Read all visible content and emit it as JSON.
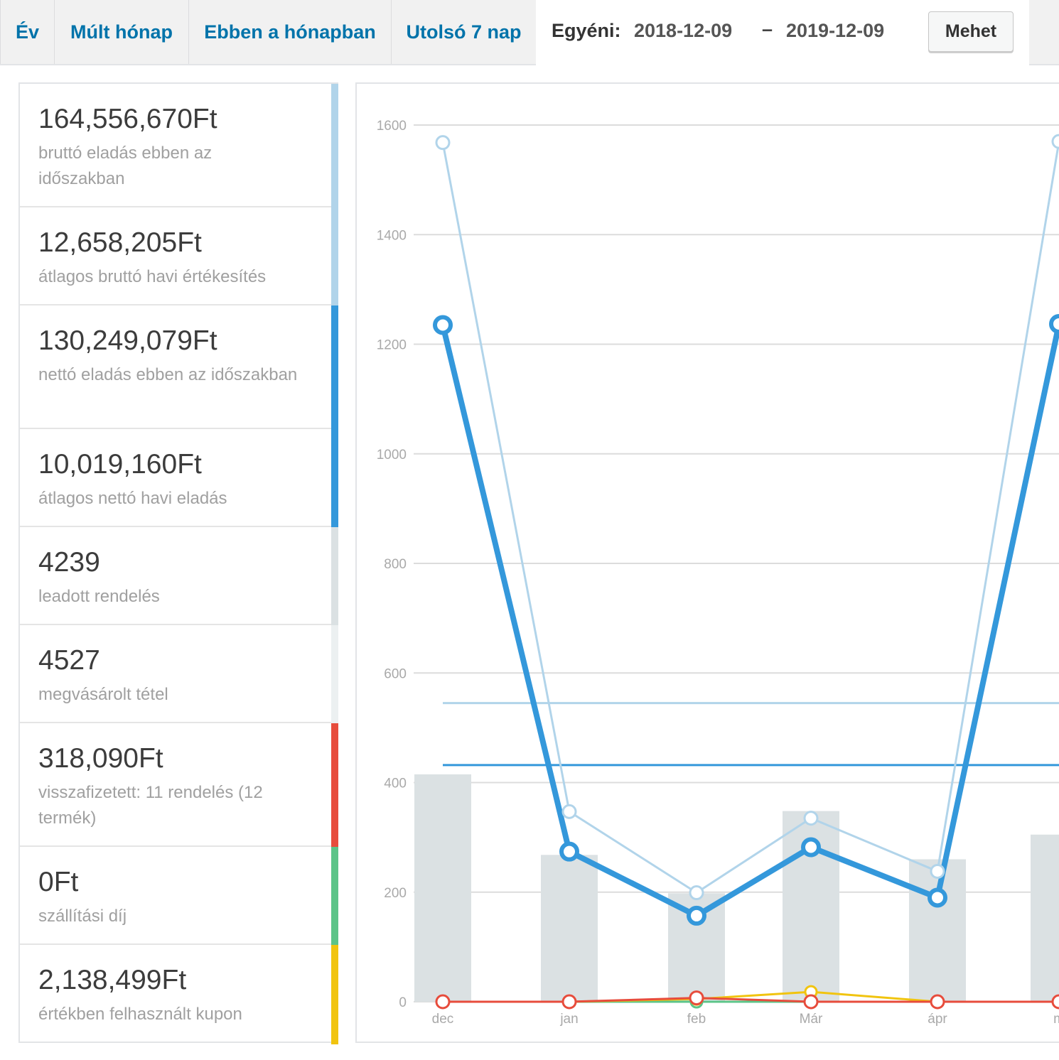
{
  "range_tabs": [
    {
      "label": "Év"
    },
    {
      "label": "Múlt hónap"
    },
    {
      "label": "Ebben a hónapban"
    },
    {
      "label": "Utolsó 7 nap"
    }
  ],
  "custom_range": {
    "label": "Egyéni:",
    "from": "2018-12-09",
    "separator": "–",
    "to": "2019-12-09",
    "go_button": "Mehet"
  },
  "legend": [
    {
      "value": "164,556,670Ft",
      "desc": "bruttó eladás ebben az időszakban",
      "color": "#b1d4ea"
    },
    {
      "value": "12,658,205Ft",
      "desc": "átlagos bruttó havi értékesítés",
      "color": "#b1d4ea"
    },
    {
      "value": "130,249,079Ft",
      "desc": "nettó eladás ebben az időszakban",
      "color": "#3498db"
    },
    {
      "value": "10,019,160Ft",
      "desc": "átlagos nettó havi eladás",
      "color": "#3498db"
    },
    {
      "value": "4239",
      "desc": "leadott rendelés",
      "color": "#dbe1e3"
    },
    {
      "value": "4527",
      "desc": "megvásárolt tétel",
      "color": "#ecf0f1"
    },
    {
      "value": "318,090Ft",
      "desc": "visszafizetett: 11 rendelés (12 termék)",
      "color": "#e74c3c"
    },
    {
      "value": "0Ft",
      "desc": "szállítási díj",
      "color": "#5cc488"
    },
    {
      "value": "2,138,499Ft",
      "desc": "értékben felhasznált kupon",
      "color": "#f1c40f"
    }
  ],
  "chart_data": {
    "type": "line",
    "categories": [
      "dec",
      "jan",
      "feb",
      "Már",
      "ápr",
      "m"
    ],
    "ylim": [
      0,
      1600
    ],
    "yticks": [
      0,
      200,
      400,
      600,
      800,
      1000,
      1200,
      1400,
      1600
    ],
    "bars": {
      "color": "#dbe1e3",
      "values": [
        415,
        268,
        198,
        348,
        260,
        305
      ]
    },
    "series": [
      {
        "key": "gross",
        "color": "#b1d4ea",
        "values": [
          1568,
          347,
          199,
          335,
          238,
          1570
        ]
      },
      {
        "key": "net",
        "color": "#3498db",
        "values": [
          1235,
          274,
          157,
          282,
          190,
          1237
        ]
      },
      {
        "key": "shipping",
        "color": "#5cc488",
        "values": [
          0,
          0,
          0,
          0,
          0,
          0
        ]
      },
      {
        "key": "coupons",
        "color": "#f1c40f",
        "values": [
          0,
          0,
          5,
          18,
          0,
          0
        ]
      },
      {
        "key": "refunds",
        "color": "#e74c3c",
        "values": [
          0,
          0,
          7,
          0,
          0,
          0
        ]
      }
    ],
    "reference_lines": [
      {
        "key": "avg-gross",
        "color": "#b1d4ea",
        "value": 545
      },
      {
        "key": "avg-net",
        "color": "#3498db",
        "value": 432
      }
    ],
    "grid": true,
    "legend": "left"
  }
}
